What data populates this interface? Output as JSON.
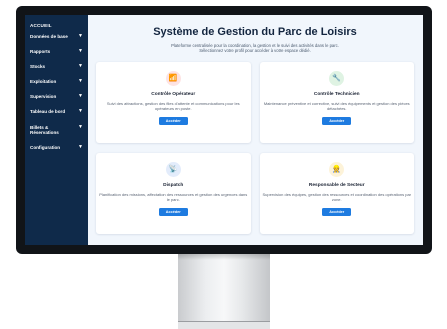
{
  "sidebar": {
    "home": "ACCUEIL",
    "items": [
      {
        "label": "Données de base",
        "arrow": "▼"
      },
      {
        "label": "Rapports",
        "arrow": "▼"
      },
      {
        "label": "Stocks",
        "arrow": "▼"
      },
      {
        "label": "Exploitation",
        "arrow": "▼"
      },
      {
        "label": "Supervision",
        "arrow": "▼"
      },
      {
        "label": "Tableau de bord",
        "arrow": "▼"
      },
      {
        "label": "Billets &\nRéservations",
        "arrow": "▼"
      },
      {
        "label": "Configuration",
        "arrow": "▼"
      }
    ]
  },
  "main": {
    "title": "Système de Gestion du Parc de Loisirs",
    "subtitle_line1": "Plateforme centralisée pour la coordination, la gestion et le suivi des activités dans le parc.",
    "subtitle_line2": "Sélectionnez votre profil pour accéder à votre espace dédié.",
    "cards": [
      {
        "icon": "📶",
        "icon_name": "signal-bars-icon",
        "icon_bg": "#fde3e3",
        "title": "Contrôle Opérateur",
        "desc": "Suivi des attractions, gestion des files d'attente et communications pour les opérateurs en poste.",
        "button": "Accéder"
      },
      {
        "icon": "🔧",
        "icon_name": "wrench-icon",
        "icon_bg": "#dff3e3",
        "title": "Contrôle Technicien",
        "desc": "Maintenance préventive et corrective, suivi des équipements et gestion des pièces détachées.",
        "button": "Accéder"
      },
      {
        "icon": "📡",
        "icon_name": "satellite-dish-icon",
        "icon_bg": "#e3ecfb",
        "title": "Dispatch",
        "desc": "Planification des missions, affectation des ressources et gestion des urgences dans le parc.",
        "button": "Accéder"
      },
      {
        "icon": "👷",
        "icon_name": "worker-icon",
        "icon_bg": "#fdf3d9",
        "title": "Responsable de Secteur",
        "desc": "Supervision des équipes, gestion des ressources et coordination des opérations par zone.",
        "button": "Accéder"
      }
    ]
  },
  "colors": {
    "sidebar_bg": "#0f2a4a",
    "accent": "#1e7be0",
    "screen_bg": "#f1f6fc"
  }
}
